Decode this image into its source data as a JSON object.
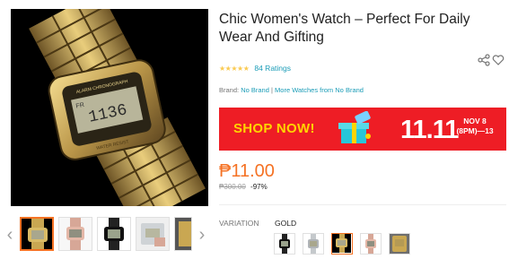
{
  "product": {
    "title": "Chic Women's Watch – Perfect For Daily Wear And Gifting",
    "ratings_text": "84 Ratings",
    "stars_glyph": "★★★★★",
    "rating": 4.5,
    "brand_label": "Brand:",
    "brand_value": "No Brand",
    "brand_separator": "|",
    "more_from": "More Watches from No Brand",
    "price": "₱11.00",
    "original_price": "₱300.00",
    "discount": "-97%",
    "variation_label": "VARIATION",
    "variation_value": "GOLD"
  },
  "banner": {
    "left_text": "SHOP NOW!",
    "event_text": "11.11",
    "date_line1": "NOV 8",
    "date_line2": "(8PM)—13"
  },
  "gallery": {
    "thumbnails": [
      "gold watch",
      "rose gold watch",
      "black watch",
      "silver watch",
      "gold watch"
    ],
    "active_index": 0,
    "left_arrow": "‹",
    "right_arrow": "›"
  },
  "icons": {
    "share": "share-icon",
    "wishlist": "heart-icon"
  },
  "colors": {
    "accent": "#f57224",
    "link": "#1a9cb7",
    "banner_red": "#ee1d25",
    "banner_yellow": "#ffd400",
    "stars": "#faca51"
  },
  "swatches": [
    "black",
    "silver",
    "gold",
    "rose gold",
    "gold band"
  ],
  "active_swatch": 2
}
